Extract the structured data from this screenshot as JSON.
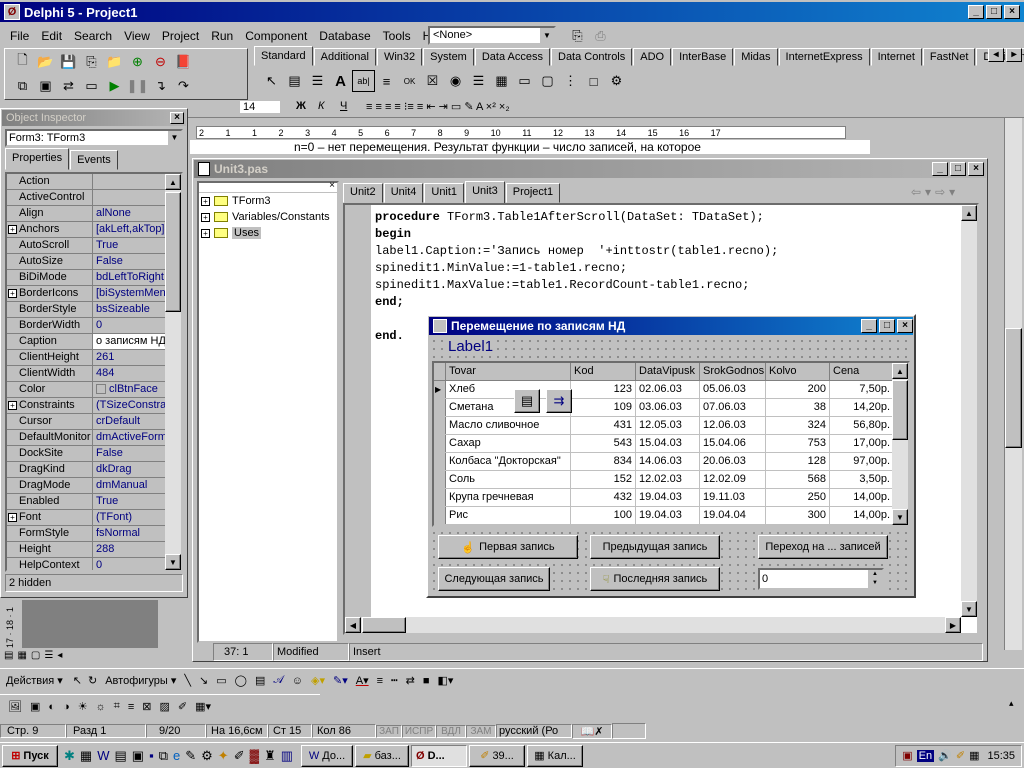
{
  "ide": {
    "title": "Delphi 5 - Project1",
    "menu": [
      "File",
      "Edit",
      "Search",
      "View",
      "Project",
      "Run",
      "Component",
      "Database",
      "Tools",
      "Help"
    ],
    "desktop_combo": "<None>",
    "palette_tabs": [
      "Standard",
      "Additional",
      "Win32",
      "System",
      "Data Access",
      "Data Controls",
      "ADO",
      "InterBase",
      "Midas",
      "InternetExpress",
      "Internet",
      "FastNet",
      "Decision C"
    ]
  },
  "doc_behind": {
    "font_size": "14",
    "text": "n=0 – нет перемещения. Результат функции – число записей, на которое"
  },
  "ruler": [
    "2",
    "1",
    "1",
    "2",
    "3",
    "4",
    "5",
    "6",
    "7",
    "8",
    "9",
    "10",
    "11",
    "12",
    "13",
    "14",
    "15",
    "16",
    "17"
  ],
  "inspector": {
    "title": "Object Inspector",
    "object": "Form3: TForm3",
    "tabs": [
      "Properties",
      "Events"
    ],
    "status": "2 hidden",
    "rows": [
      {
        "k": "Action",
        "v": "",
        "p": false
      },
      {
        "k": "ActiveControl",
        "v": "",
        "p": false
      },
      {
        "k": "Align",
        "v": "alNone",
        "p": false
      },
      {
        "k": "Anchors",
        "v": "[akLeft,akTop]",
        "p": true
      },
      {
        "k": "AutoScroll",
        "v": "True",
        "p": false
      },
      {
        "k": "AutoSize",
        "v": "False",
        "p": false
      },
      {
        "k": "BiDiMode",
        "v": "bdLeftToRight",
        "p": false
      },
      {
        "k": "BorderIcons",
        "v": "[biSystemMenu,",
        "p": true
      },
      {
        "k": "BorderStyle",
        "v": "bsSizeable",
        "p": false
      },
      {
        "k": "BorderWidth",
        "v": "0",
        "p": false
      },
      {
        "k": "Caption",
        "v": "о записям НД",
        "p": false
      },
      {
        "k": "ClientHeight",
        "v": "261",
        "p": false
      },
      {
        "k": "ClientWidth",
        "v": "484",
        "p": false
      },
      {
        "k": "Color",
        "v": "clBtnFace",
        "p": false
      },
      {
        "k": "Constraints",
        "v": "(TSizeConstrain",
        "p": true
      },
      {
        "k": "Cursor",
        "v": "crDefault",
        "p": false
      },
      {
        "k": "DefaultMonitor",
        "v": "dmActiveForm",
        "p": false
      },
      {
        "k": "DockSite",
        "v": "False",
        "p": false
      },
      {
        "k": "DragKind",
        "v": "dkDrag",
        "p": false
      },
      {
        "k": "DragMode",
        "v": "dmManual",
        "p": false
      },
      {
        "k": "Enabled",
        "v": "True",
        "p": false
      },
      {
        "k": "Font",
        "v": "(TFont)",
        "p": true
      },
      {
        "k": "FormStyle",
        "v": "fsNormal",
        "p": false
      },
      {
        "k": "Height",
        "v": "288",
        "p": false
      },
      {
        "k": "HelpContext",
        "v": "0",
        "p": false
      }
    ]
  },
  "editor": {
    "title": "Unit3.pas",
    "tabs": [
      "Unit2",
      "Unit4",
      "Unit1",
      "Unit3",
      "Project1"
    ],
    "selected_tab": "Unit3",
    "tree": [
      "TForm3",
      "Variables/Constants",
      "Uses"
    ],
    "code": [
      {
        "kw": "procedure ",
        "rest": "TForm3.Table1AfterScroll(DataSet: TDataSet);"
      },
      {
        "kw": "begin",
        "rest": ""
      },
      {
        "kw": "",
        "rest": "label1.Caption:='Запись номер  '+inttostr(table1.recno);"
      },
      {
        "kw": "",
        "rest": "spinedit1.MinValue:=1-table1.recno;"
      },
      {
        "kw": "",
        "rest": "spinedit1.MaxValue:=table1.RecordCount-table1.recno;"
      },
      {
        "kw": "end;",
        "rest": ""
      },
      {
        "kw": "",
        "rest": ""
      },
      {
        "kw": "end.",
        "rest": ""
      }
    ],
    "status": {
      "pos": "37:  1",
      "modified": "Modified",
      "mode": "Insert"
    }
  },
  "form": {
    "title": "Перемещение по записям НД",
    "label": "Label1",
    "columns": [
      "Tovar",
      "Kod",
      "DataVipusk",
      "SrokGodnos",
      "Kolvo",
      "Cena"
    ],
    "rows": [
      [
        "Хлеб",
        "123",
        "02.06.03",
        "05.06.03",
        "200",
        "7,50р."
      ],
      [
        "Сметана",
        "109",
        "03.06.03",
        "07.06.03",
        "38",
        "14,20р."
      ],
      [
        "Масло сливочное",
        "431",
        "12.05.03",
        "12.06.03",
        "324",
        "56,80р."
      ],
      [
        "Сахар",
        "543",
        "15.04.03",
        "15.04.06",
        "753",
        "17,00р."
      ],
      [
        "Колбаса \"Докторская\"",
        "834",
        "14.06.03",
        "20.06.03",
        "128",
        "97,00р."
      ],
      [
        "Соль",
        "152",
        "12.02.03",
        "12.02.09",
        "568",
        "3,50р."
      ],
      [
        "Крупа гречневая",
        "432",
        "19.04.03",
        "19.11.03",
        "250",
        "14,00р."
      ],
      [
        "Рис",
        "100",
        "19.04.03",
        "19.04.04",
        "300",
        "14,00р."
      ]
    ],
    "buttons": {
      "first": "Первая запись",
      "prev": "Предыдущая запись",
      "goto": "Переход на ... записей",
      "next": "Следующая запись",
      "last": "Последняя запись"
    },
    "spin_value": "0"
  },
  "word": {
    "draw_actions": "Действия",
    "autoshapes": "Автофигуры",
    "status": {
      "page": "Стр. 9",
      "section": "Разд 1",
      "pages": "9/20",
      "at": "На 16,6см",
      "line": "Ст 15",
      "col": "Кол 86",
      "rec": "ЗАП",
      "trk": "ИСПР",
      "ext": "ВДЛ",
      "ovr": "ЗАМ",
      "lang": "русский (Ро"
    },
    "vruler": [
      "17",
      "18",
      "1"
    ]
  },
  "taskbar": {
    "start": "Пуск",
    "tasks": [
      "До...",
      "баз...",
      "D...",
      "39...",
      "Кал..."
    ],
    "lang": "En",
    "time": "15:35"
  }
}
